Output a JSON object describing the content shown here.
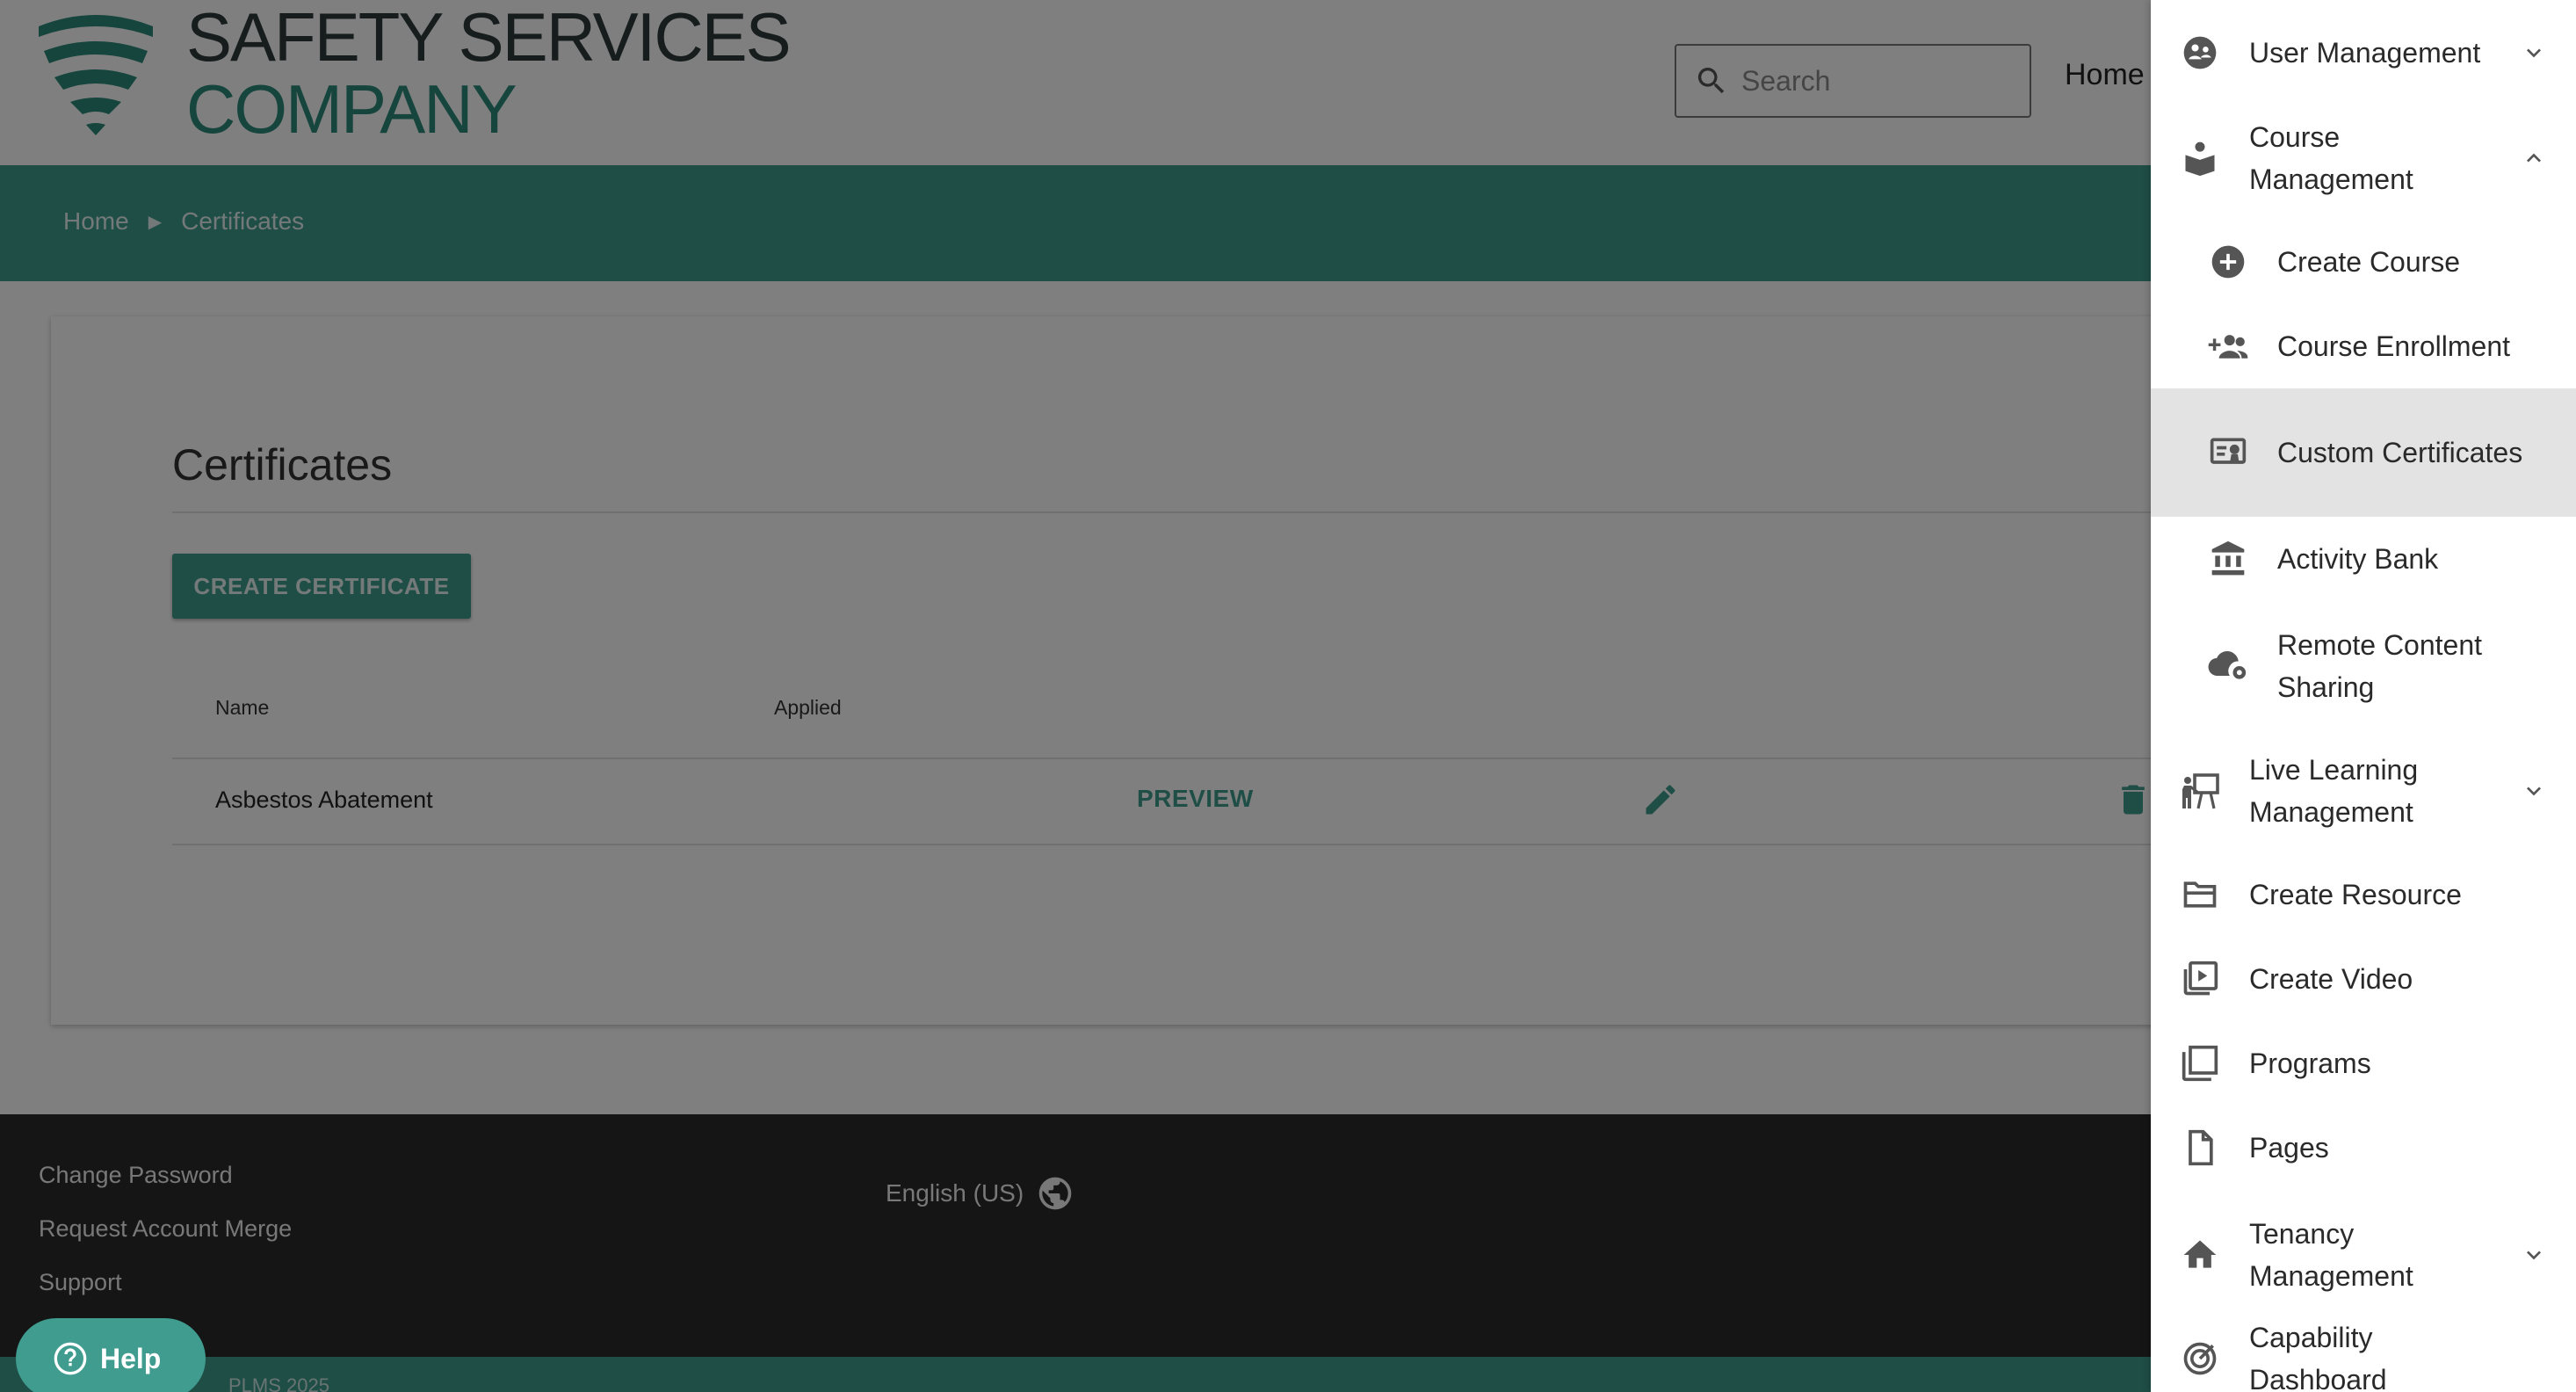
{
  "header": {
    "logo_line1": "SAFETY SERVICES",
    "logo_line2": "COMPANY",
    "search_placeholder": "Search",
    "home_link": "Home"
  },
  "breadcrumb": {
    "items": [
      "Home",
      "Certificates"
    ]
  },
  "main": {
    "title": "Certificates",
    "create_button": "CREATE CERTIFICATE",
    "columns": [
      "Name",
      "Applied"
    ],
    "rows": [
      {
        "name": "Asbestos Abatement",
        "preview_label": "PREVIEW"
      }
    ]
  },
  "footer": {
    "links": [
      "Change Password",
      "Request Account Merge",
      "Support"
    ],
    "language": "English (US)",
    "copyright": "PLMS 2025",
    "help_label": "Help"
  },
  "drawer": {
    "items": [
      {
        "label": "User Management",
        "icon": "group-icon",
        "chevron": "down"
      },
      {
        "label": "Course Management",
        "icon": "book-reader-icon",
        "chevron": "up"
      },
      {
        "label": "Create Course",
        "icon": "add-circle-icon"
      },
      {
        "label": "Course Enrollment",
        "icon": "group-add-icon"
      },
      {
        "label": "Custom Certificates",
        "icon": "certificate-icon",
        "active": true
      },
      {
        "label": "Activity Bank",
        "icon": "bank-icon"
      },
      {
        "label": "Remote Content Sharing",
        "icon": "cloud-settings-icon"
      },
      {
        "label": "Live Learning Management",
        "icon": "presenter-icon",
        "chevron": "down"
      },
      {
        "label": "Create Resource",
        "icon": "folder-open-icon"
      },
      {
        "label": "Create Video",
        "icon": "video-library-icon"
      },
      {
        "label": "Programs",
        "icon": "filter-none-icon"
      },
      {
        "label": "Pages",
        "icon": "page-icon"
      },
      {
        "label": "Tenancy Management",
        "icon": "home-icon",
        "chevron": "down"
      },
      {
        "label": "Capability Dashboard",
        "icon": "track-changes-icon"
      }
    ]
  },
  "colors": {
    "brand_teal": "#3f9c8f",
    "footer_dark": "#2b2b2b",
    "active_item_bg": "#e3e3e3"
  }
}
